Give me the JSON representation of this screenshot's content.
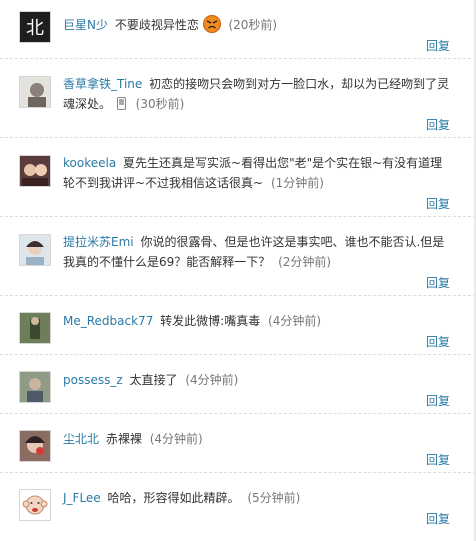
{
  "reply_label": "回复",
  "comments": [
    {
      "user": "巨星N少",
      "text": "不要歧视异性恋",
      "time": "(20秒前)"
    },
    {
      "user": "香草拿铁_Tine",
      "text": "初恋的接吻只会吻到对方一脸口水，却以为已经吻到了灵魂深处。",
      "time": "(30秒前)"
    },
    {
      "user": "kookeela",
      "text": "夏先生还真是写实派~看得出您\"老\"是个实在银~有没有道理轮不到我讲评~不过我相信这话很真~",
      "time": "(1分钟前)"
    },
    {
      "user": "提拉米苏Emi",
      "text": "你说的很露骨、但是也许这是事实吧、谁也不能否认.但是我真的不懂什么是69？能否解释一下？",
      "time": "(2分钟前)"
    },
    {
      "user": "Me_Redback77",
      "text": "转发此微博:嘴真毒",
      "time": "(4分钟前)"
    },
    {
      "user": "possess_z",
      "text": "太直接了",
      "time": "(4分钟前)"
    },
    {
      "user": "尘北北",
      "text": "赤裸裸",
      "time": "(4分钟前)"
    },
    {
      "user": "J_FLee",
      "text": "哈哈，形容得如此精辟。",
      "time": "(5分钟前)"
    }
  ],
  "icons": {
    "emoticon": "angry-face-icon",
    "phone": "mobile-phone-icon"
  },
  "colors": {
    "link": "#2a7aa6",
    "text": "#333333",
    "time": "#777777",
    "divider": "#dcdcdc"
  }
}
